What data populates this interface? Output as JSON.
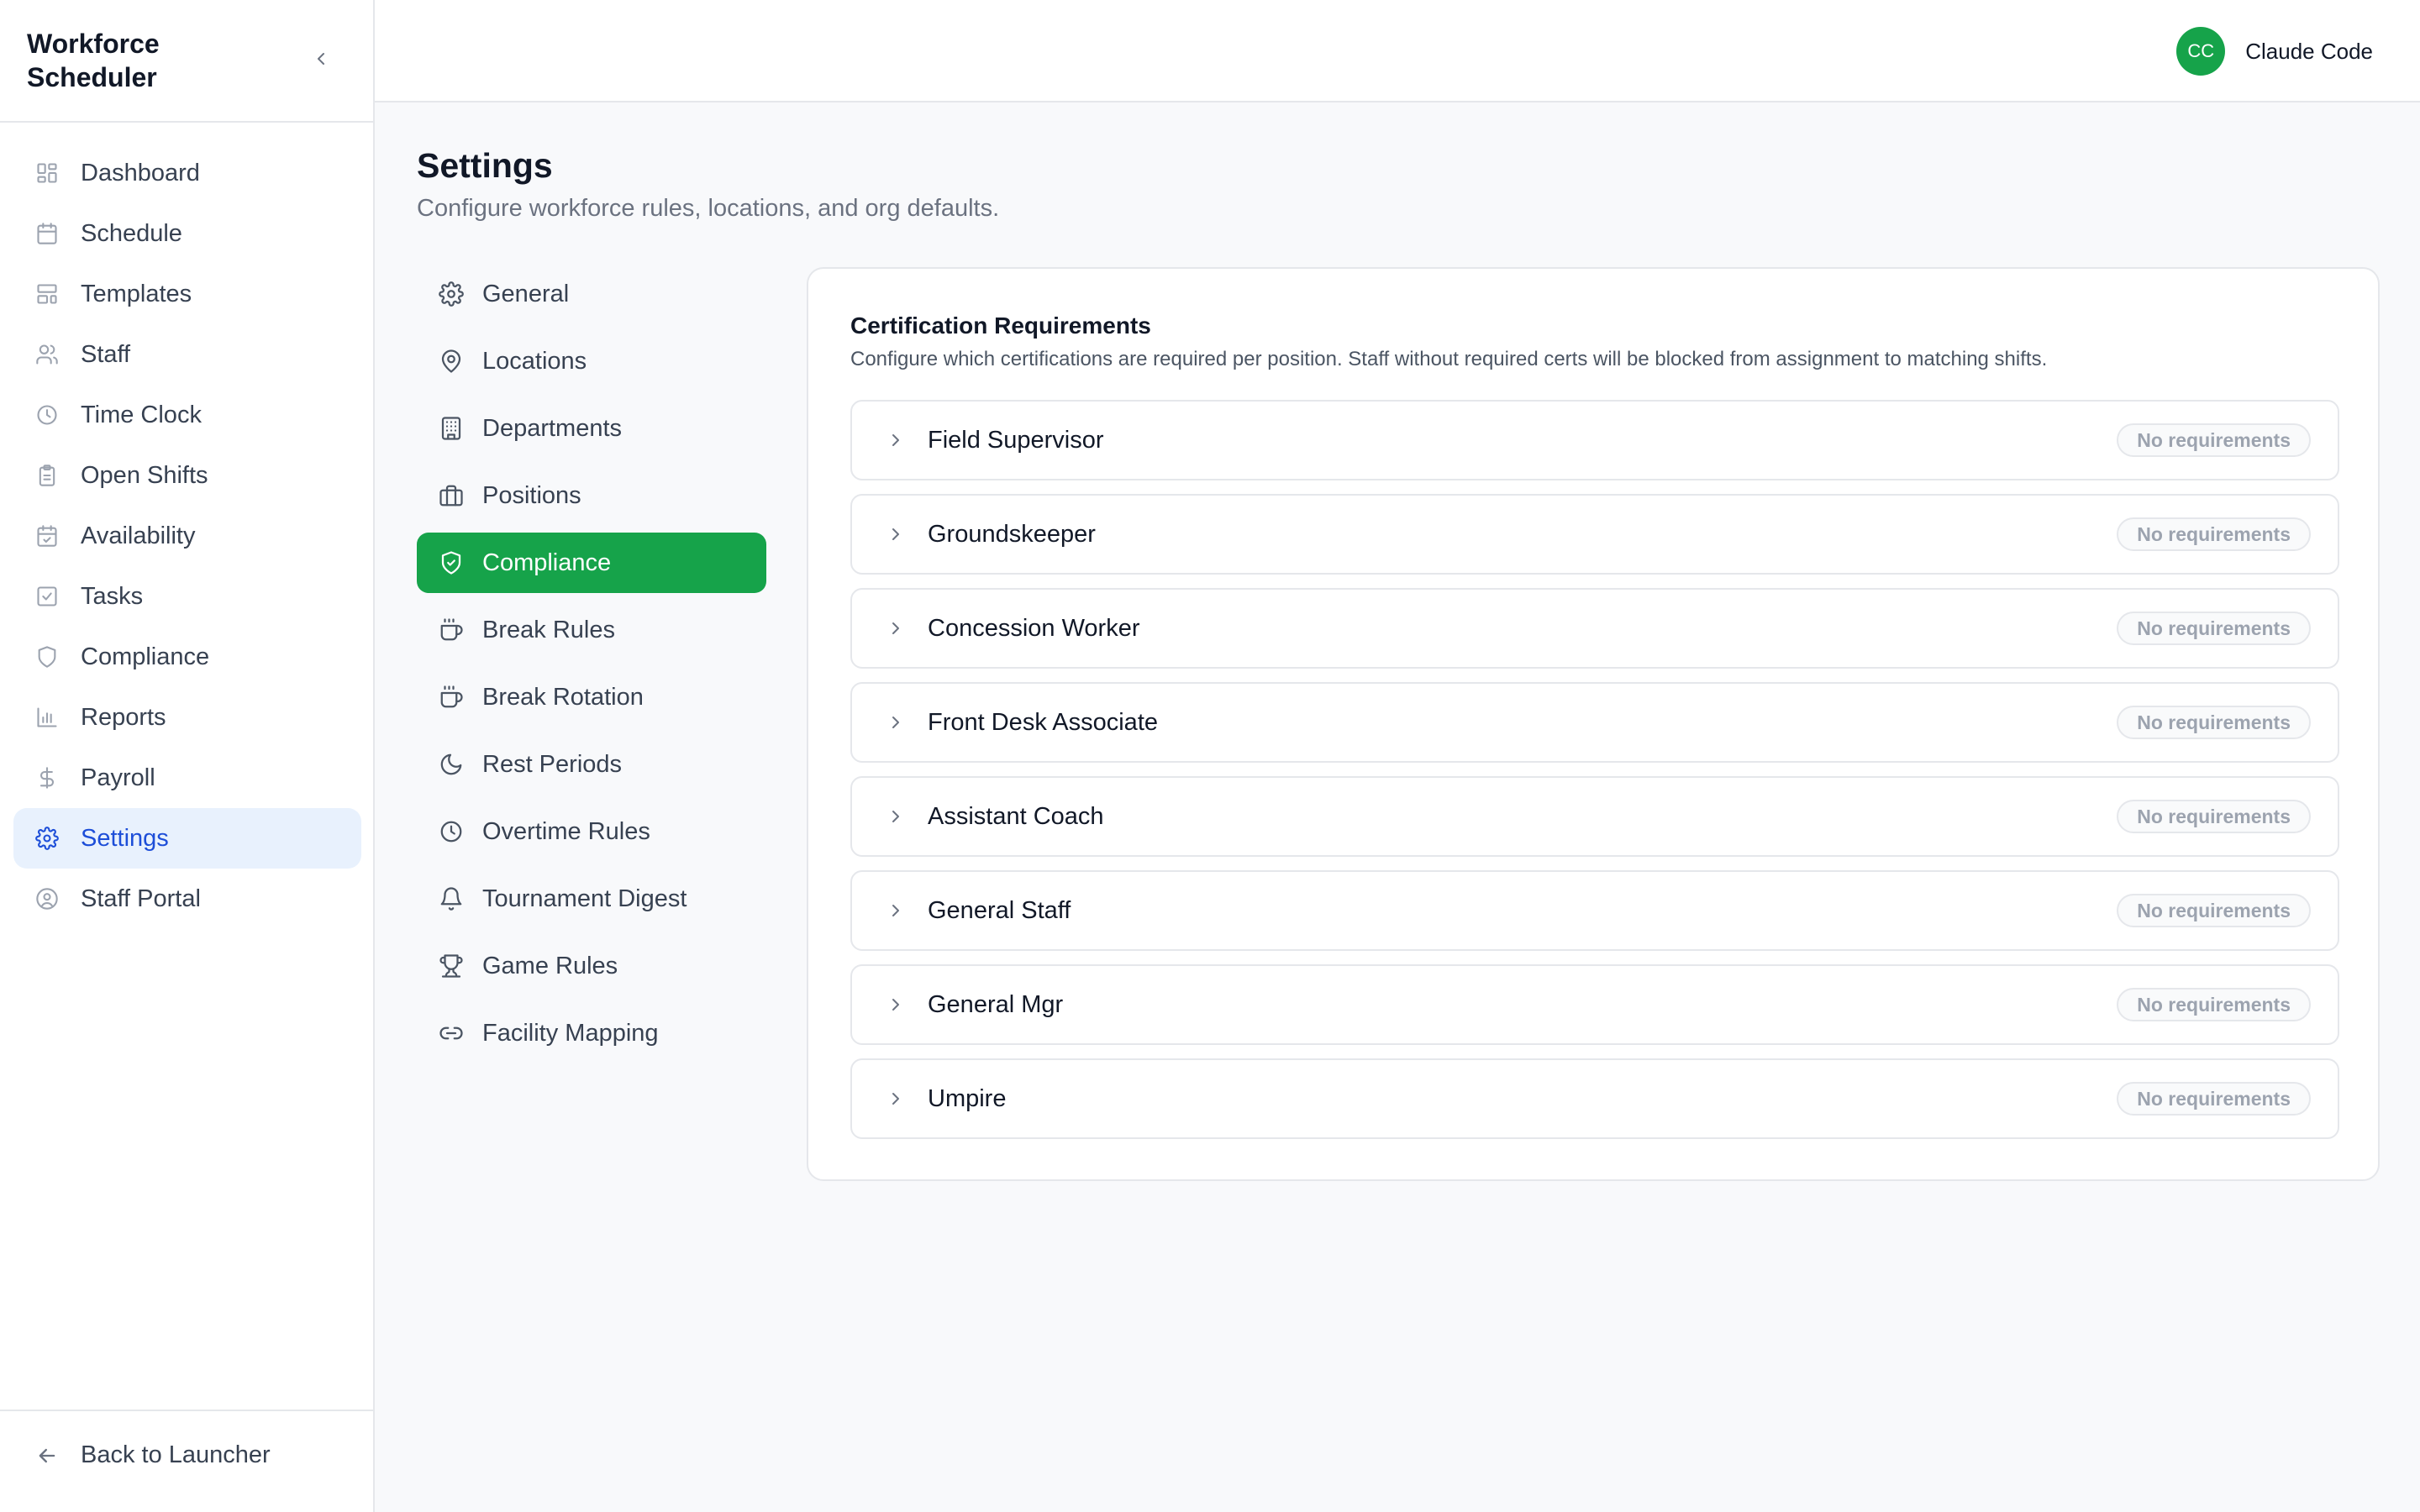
{
  "app": {
    "title": "Workforce Scheduler"
  },
  "sidebar": {
    "items": [
      {
        "label": "Dashboard",
        "icon": "dashboard-icon"
      },
      {
        "label": "Schedule",
        "icon": "calendar-icon"
      },
      {
        "label": "Templates",
        "icon": "templates-icon"
      },
      {
        "label": "Staff",
        "icon": "users-icon"
      },
      {
        "label": "Time Clock",
        "icon": "clock-icon"
      },
      {
        "label": "Open Shifts",
        "icon": "clipboard-icon"
      },
      {
        "label": "Availability",
        "icon": "calendar-check-icon"
      },
      {
        "label": "Tasks",
        "icon": "checkbox-icon"
      },
      {
        "label": "Compliance",
        "icon": "shield-icon"
      },
      {
        "label": "Reports",
        "icon": "bar-chart-icon"
      },
      {
        "label": "Payroll",
        "icon": "dollar-icon"
      },
      {
        "label": "Settings",
        "icon": "gear-icon",
        "active": true
      },
      {
        "label": "Staff Portal",
        "icon": "user-circle-icon"
      }
    ],
    "back_label": "Back to Launcher"
  },
  "user": {
    "initials": "CC",
    "name": "Claude Code",
    "avatar_color": "#16a34a"
  },
  "page": {
    "title": "Settings",
    "subtitle": "Configure workforce rules, locations, and org defaults."
  },
  "settings_nav": {
    "items": [
      {
        "label": "General",
        "icon": "gear-icon"
      },
      {
        "label": "Locations",
        "icon": "map-pin-icon"
      },
      {
        "label": "Departments",
        "icon": "building-icon"
      },
      {
        "label": "Positions",
        "icon": "briefcase-icon"
      },
      {
        "label": "Compliance",
        "icon": "shield-check-icon",
        "active": true
      },
      {
        "label": "Break Rules",
        "icon": "coffee-icon"
      },
      {
        "label": "Break Rotation",
        "icon": "coffee-icon"
      },
      {
        "label": "Rest Periods",
        "icon": "moon-icon"
      },
      {
        "label": "Overtime Rules",
        "icon": "clock-icon"
      },
      {
        "label": "Tournament Digest",
        "icon": "bell-icon"
      },
      {
        "label": "Game Rules",
        "icon": "trophy-icon"
      },
      {
        "label": "Facility Mapping",
        "icon": "link-icon"
      }
    ]
  },
  "certifications": {
    "title": "Certification Requirements",
    "description": "Configure which certifications are required per position. Staff without required certs will be blocked from assignment to matching shifts.",
    "positions": [
      {
        "name": "Field Supervisor",
        "status": "No requirements"
      },
      {
        "name": "Groundskeeper",
        "status": "No requirements"
      },
      {
        "name": "Concession Worker",
        "status": "No requirements"
      },
      {
        "name": "Front Desk Associate",
        "status": "No requirements"
      },
      {
        "name": "Assistant Coach",
        "status": "No requirements"
      },
      {
        "name": "General Staff",
        "status": "No requirements"
      },
      {
        "name": "General Mgr",
        "status": "No requirements"
      },
      {
        "name": "Umpire",
        "status": "No requirements"
      }
    ]
  },
  "colors": {
    "accent_green": "#16a34a",
    "active_blue": "#1d4ed8",
    "active_blue_bg": "#e8f1fd"
  }
}
